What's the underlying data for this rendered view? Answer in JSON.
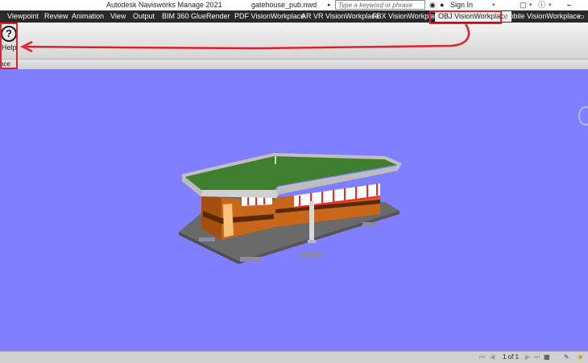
{
  "titlebar": {
    "app_title": "Autodesk Navisworks Manage 2021",
    "file_name": "gatehouse_pub.nwd",
    "search_placeholder": "Type a keyword or phrase",
    "sign_in": "Sign In"
  },
  "tabs": [
    {
      "label": "Viewpoint"
    },
    {
      "label": "Review"
    },
    {
      "label": "Animation"
    },
    {
      "label": "View"
    },
    {
      "label": "Output"
    },
    {
      "label": "BIM 360 Glue"
    },
    {
      "label": "Render"
    },
    {
      "label": "PDF VisionWorkplace"
    },
    {
      "label": "AR VR VisionWorkplace"
    },
    {
      "label": "FBX VisionWorkplace"
    },
    {
      "label": "OBJ VisionWorkplace",
      "active": true
    },
    {
      "label": "Mobile VisionWorkplace"
    }
  ],
  "ribbon": {
    "help_label": "Help",
    "panel_label": "ace"
  },
  "status": {
    "page_indicator": "1 of 1"
  },
  "colors": {
    "viewport_bg": "#7f7fff",
    "annotation": "#e0202a",
    "roof": "#3f7f2f",
    "wall": "#c8661a",
    "base": "#6a6a6a"
  }
}
